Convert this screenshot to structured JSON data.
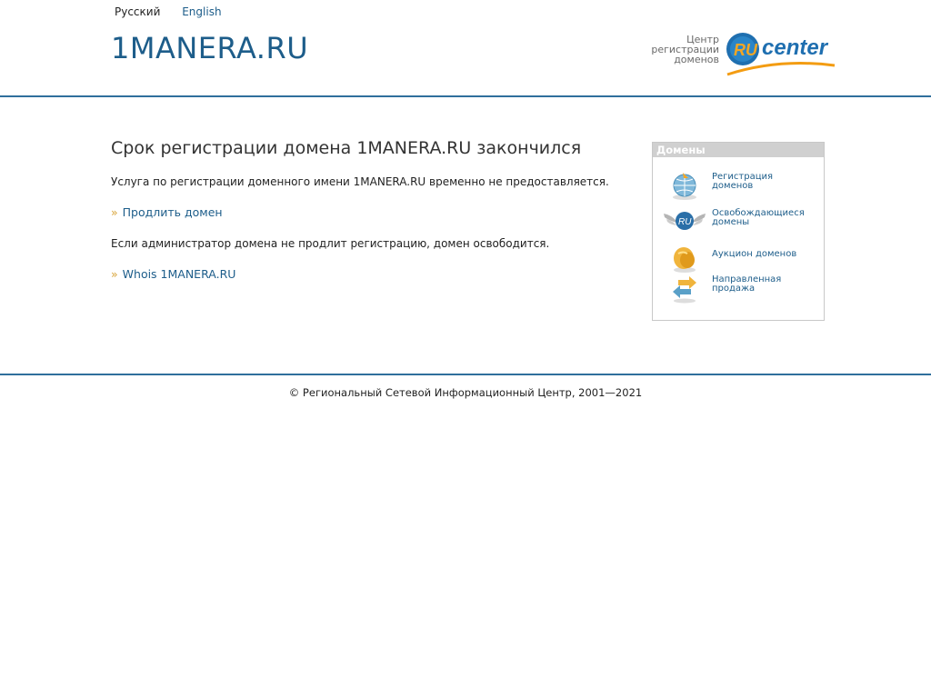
{
  "lang": {
    "ru": "Русский",
    "en": "English"
  },
  "site_title": "1MANERA.RU",
  "logo": {
    "line1": "Центр",
    "line2": "регистрации",
    "line3": "доменов",
    "badge": "RU",
    "word": "center"
  },
  "main": {
    "heading": "Срок регистрации домена 1MANERA.RU закончился",
    "service_text": "Услуга по регистрации доменного имени 1MANERA.RU временно не предоставляется.",
    "renew_mark": "»",
    "renew_link": "Продлить домен",
    "admin_text": "Если администратор домена не продлит регистрацию, домен освободится.",
    "whois_mark": "»",
    "whois_link": "Whois 1MANERA.RU"
  },
  "panel": {
    "title": "Домены",
    "items": [
      {
        "line1": "Регистрация",
        "line2": "доменов",
        "icon": "globe-icon"
      },
      {
        "line1": "Освобождающиеся",
        "line2": "домены",
        "icon": "winged-ru-icon",
        "badge": "RU"
      },
      {
        "line1": "Аукцион доменов",
        "line2": "",
        "icon": "auction-icon"
      },
      {
        "line1": "Направленная",
        "line2": "продажа",
        "icon": "arrows-icon"
      }
    ]
  },
  "footer": "© Региональный Сетевой Информационный Центр, 2001—2021",
  "colors": {
    "link": "#1d5d8a",
    "rule": "#2f6f9c",
    "accent": "#f39c12",
    "panel_head": "#d0d0d0"
  }
}
